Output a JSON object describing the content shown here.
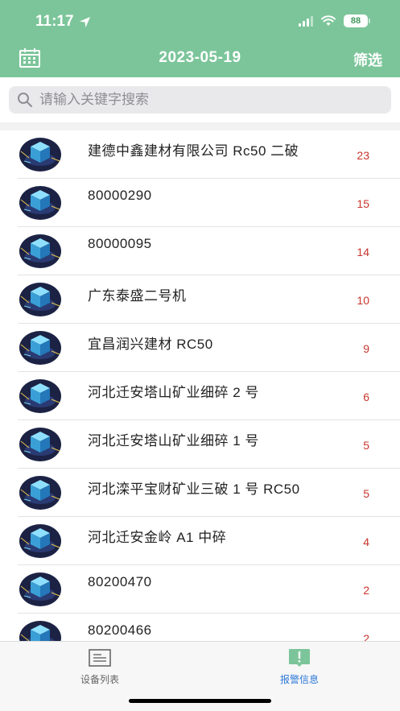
{
  "status": {
    "time": "11:17",
    "battery": "88"
  },
  "nav": {
    "title": "2023-05-19",
    "filter_label": "筛选"
  },
  "search": {
    "placeholder": "请输入关键字搜索"
  },
  "devices": [
    {
      "name": "建德中鑫建材有限公司 Rc50 二破",
      "count": "23"
    },
    {
      "name": "80000290",
      "count": "15"
    },
    {
      "name": "80000095",
      "count": "14"
    },
    {
      "name": "广东泰盛二号机",
      "count": "10"
    },
    {
      "name": "宜昌润兴建材 RC50",
      "count": "9"
    },
    {
      "name": "河北迁安塔山矿业细碎 2 号",
      "count": "6"
    },
    {
      "name": "河北迁安塔山矿业细碎 1 号",
      "count": "5"
    },
    {
      "name": "河北滦平宝财矿业三破 1 号 RC50",
      "count": "5"
    },
    {
      "name": "河北迁安金岭 A1 中碎",
      "count": "4"
    },
    {
      "name": "80200470",
      "count": "2"
    },
    {
      "name": "80200466",
      "count": "2"
    }
  ],
  "tabs": {
    "devices_label": "设备列表",
    "alarms_label": "报警信息"
  },
  "colors": {
    "header": "#7cc59a",
    "count": "#c9352d",
    "active_tab": "#2d78d8"
  }
}
